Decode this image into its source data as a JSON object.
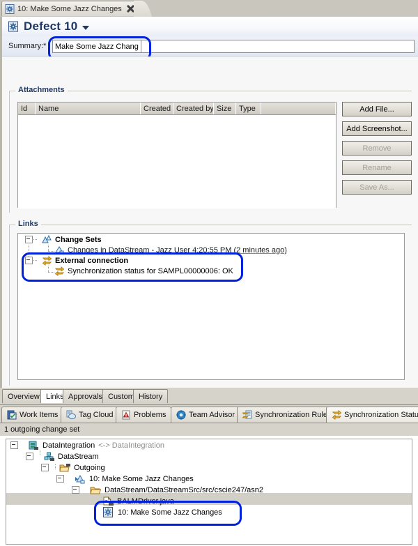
{
  "window": {
    "editor_tab": {
      "label": "10: Make Some Jazz Changes",
      "icon": "defect-icon",
      "close_icon": "close-icon"
    }
  },
  "header": {
    "icon": "defect-icon",
    "title": "Defect 10",
    "dropdown_icon": "caret-down-icon"
  },
  "summary": {
    "label": "Summary:*",
    "value": "Make Some Jazz Changes",
    "placeholder": "Make Some Jazz Changes",
    "highlight_color": "#0022dd"
  },
  "attachments": {
    "legend": "Attachments",
    "columns": [
      "Id",
      "Name",
      "Created",
      "Created by",
      "Size",
      "Type",
      ""
    ],
    "rows": [],
    "buttons": [
      {
        "label": "Add File...",
        "enabled": true
      },
      {
        "label": "Add Screenshot...",
        "enabled": true
      },
      {
        "label": "Remove",
        "enabled": false
      },
      {
        "label": "Rename",
        "enabled": false
      },
      {
        "label": "Save As...",
        "enabled": false
      }
    ]
  },
  "links": {
    "legend": "Links",
    "tree": [
      {
        "label": "Change Sets",
        "icon": "change-set-group-icon",
        "bold": true,
        "expanded": true,
        "highlighted": false
      },
      {
        "label": "Changes in DataStream - Jazz User 4:20:55 PM (2 minutes ago)",
        "icon": "change-set-icon",
        "bold": false,
        "link": true,
        "highlighted": false
      },
      {
        "label": "External connection",
        "icon": "sync-arrows-icon",
        "bold": true,
        "expanded": true,
        "highlighted": true
      },
      {
        "label": "Synchronization status for SAMPL00000006: OK",
        "icon": "sync-arrows-icon",
        "bold": false,
        "highlighted": true
      }
    ]
  },
  "editor_tabs": {
    "items": [
      {
        "label": "Overview",
        "active": false
      },
      {
        "label": "Links",
        "active": true
      },
      {
        "label": "Approvals",
        "active": false
      },
      {
        "label": "Custom",
        "active": false
      },
      {
        "label": "History",
        "active": false
      }
    ]
  },
  "view_tabs": {
    "items": [
      {
        "label": "Work Items",
        "icon": "work-items-icon",
        "active": false
      },
      {
        "label": "Tag Cloud",
        "icon": "tag-cloud-icon",
        "active": false
      },
      {
        "label": "Problems",
        "icon": "problems-icon",
        "active": false
      },
      {
        "label": "Team Advisor",
        "icon": "team-advisor-icon",
        "active": false
      },
      {
        "label": "Synchronization Rules",
        "icon": "sync-rules-icon",
        "active": false
      },
      {
        "label": "Synchronization Status",
        "icon": "sync-status-icon",
        "active": true
      }
    ]
  },
  "sync_view": {
    "status_text": "1 outgoing change set",
    "tree": [
      {
        "label": "DataIntegration",
        "suffix": "<-> DataIntegration",
        "icon": "repository-icon",
        "indent": 0,
        "expanded": true
      },
      {
        "label": "DataStream",
        "suffix": "",
        "icon": "stream-icon",
        "indent": 1,
        "expanded": true
      },
      {
        "label": "Outgoing",
        "suffix": "",
        "icon": "folder-outgoing-icon",
        "indent": 2,
        "expanded": true
      },
      {
        "label": "10: Make Some Jazz Changes",
        "suffix": "",
        "icon": "change-set-icon",
        "indent": 3,
        "expanded": true
      },
      {
        "label": "DataStream/DataStreamSrc/src/cscie247/asn2",
        "suffix": "",
        "icon": "folder-icon",
        "indent": 4,
        "expanded": true
      },
      {
        "label": "BALMDriver.java",
        "suffix": "",
        "icon": "java-file-icon",
        "indent": 5,
        "expanded": false
      },
      {
        "label": "10: Make Some Jazz Changes",
        "suffix": "",
        "icon": "defect-icon",
        "indent": 5,
        "expanded": false,
        "selected": true,
        "highlighted": true
      }
    ]
  },
  "colors": {
    "highlight": "#0022dd",
    "title_blue": "#1f3864",
    "chrome": "#d6d3ca"
  }
}
